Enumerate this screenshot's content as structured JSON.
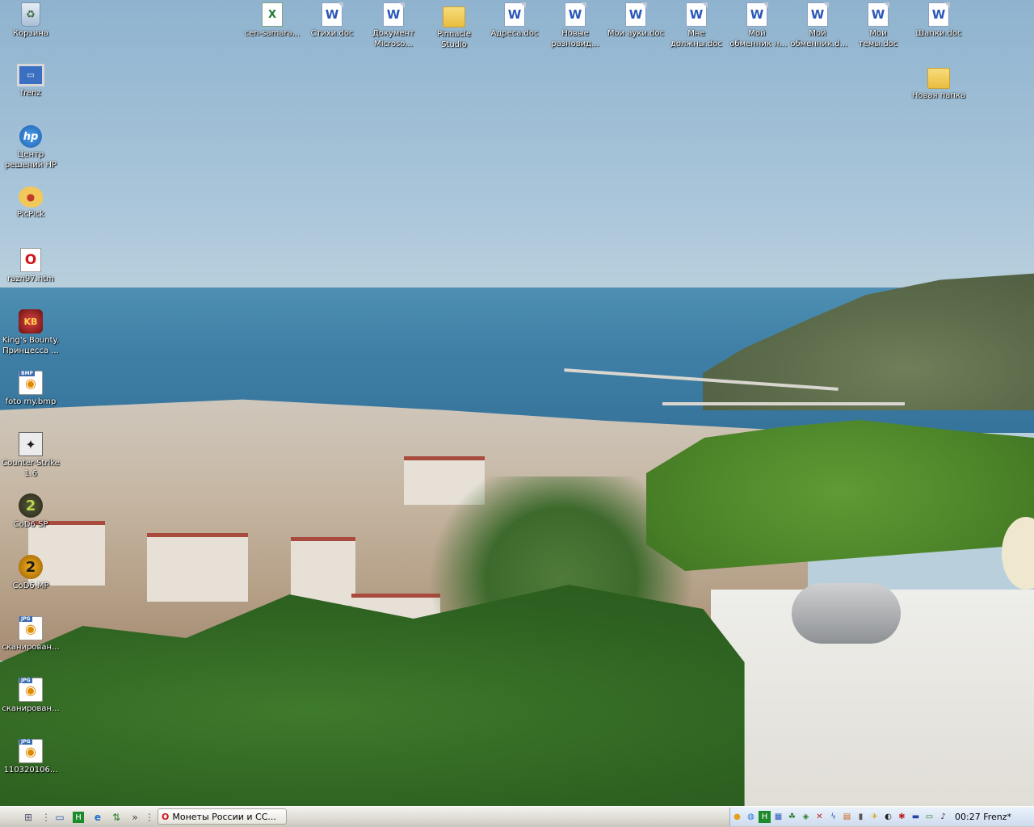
{
  "desktop": {
    "left_icons": [
      {
        "label": "Корзина",
        "icon": "recycle-bin-icon"
      },
      {
        "label": "frenz",
        "icon": "computer-icon"
      },
      {
        "label": "Центр решений HP",
        "icon": "hp-icon"
      },
      {
        "label": "PicPick",
        "icon": "palette-icon"
      },
      {
        "label": "razn97.htm",
        "icon": "opera-document-icon"
      },
      {
        "label": "King's Bounty. Принцесса ...",
        "icon": "game-icon"
      },
      {
        "label": "foto my.bmp",
        "icon": "bmp-image-icon"
      },
      {
        "label": "Counter-Strike 1.6",
        "icon": "counter-strike-icon"
      },
      {
        "label": "CoD6 SP",
        "icon": "cod-sp-icon"
      },
      {
        "label": "CoD6 MP",
        "icon": "cod-mp-icon"
      },
      {
        "label": "сканирован...",
        "icon": "jpg-image-icon"
      },
      {
        "label": "сканирован...",
        "icon": "jpg-image-icon"
      },
      {
        "label": "110320106...",
        "icon": "jpg-image-icon"
      }
    ],
    "top_icons": [
      {
        "label": "cen-samara...",
        "icon": "excel-document-icon"
      },
      {
        "label": "Стихи.doc",
        "icon": "word-document-icon"
      },
      {
        "label": "Документ Microso...",
        "icon": "word-document-icon"
      },
      {
        "label": "Pinnacle Studio",
        "icon": "folder-icon"
      },
      {
        "label": "Адреса.doc",
        "icon": "word-document-icon"
      },
      {
        "label": "Новые разновид...",
        "icon": "word-document-icon"
      },
      {
        "label": "Мои ауки.doc",
        "icon": "word-document-icon"
      },
      {
        "label": "Мне должны.doc",
        "icon": "word-document-icon"
      },
      {
        "label": "Мой обменник на форум.doc",
        "icon": "word-document-icon"
      },
      {
        "label": "Мой обменник.doc",
        "icon": "word-document-icon"
      },
      {
        "label": "Мои темы.doc",
        "icon": "word-document-icon"
      },
      {
        "label": "Шапки.doc",
        "icon": "word-document-icon"
      }
    ],
    "extra_icons": [
      {
        "label": "Новая папка",
        "icon": "folder-icon"
      }
    ]
  },
  "taskbar": {
    "quick_launch": [
      "show-desktop-icon",
      "desktop-icon",
      "app-h-icon",
      "internet-explorer-icon",
      "network-icon",
      "chevron-icon"
    ],
    "windows": [
      {
        "title": "Монеты России и СС..."
      }
    ],
    "tray_icons": [
      "palette-tray-icon",
      "update-tray-icon",
      "app-h-tray-icon",
      "network-tray-icon",
      "agent-tray-icon",
      "shield-tray-icon",
      "security-tray-icon",
      "flash-tray-icon",
      "printer-tray-icon",
      "battery-tray-icon",
      "plane-tray-icon",
      "media-tray-icon",
      "antivirus-tray-icon",
      "flag-tray-icon",
      "display-tray-icon",
      "volume-tray-icon"
    ],
    "clock": "00:27 Frenz*"
  }
}
